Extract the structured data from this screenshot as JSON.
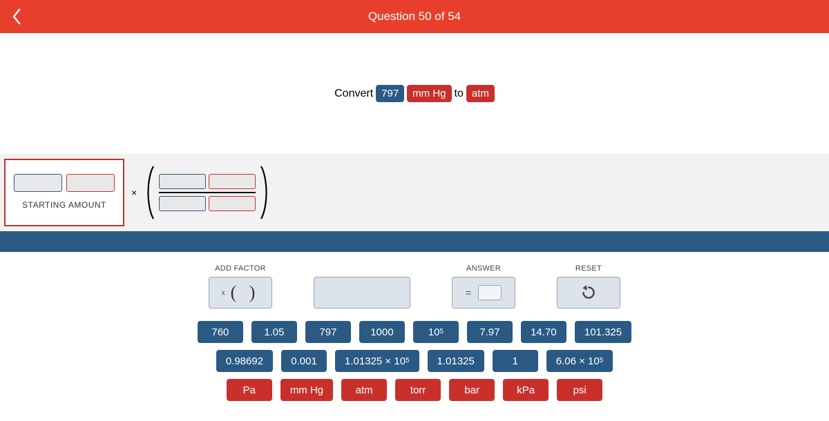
{
  "header": {
    "title": "Question 50 of 54"
  },
  "question": {
    "word_convert": "Convert",
    "value": "797",
    "from_unit": "mm Hg",
    "word_to": "to",
    "to_unit": "atm"
  },
  "equation": {
    "starting_amount_label": "STARTING AMOUNT",
    "multiply_symbol": "×"
  },
  "toolkit": {
    "add_factor_label": "ADD FACTOR",
    "answer_label": "ANSWER",
    "reset_label": "RESET",
    "equals_symbol": "="
  },
  "values_row1": [
    {
      "text": "760"
    },
    {
      "text": "1.05"
    },
    {
      "text": "797"
    },
    {
      "text": "1000"
    },
    {
      "text": "10",
      "sup": "5"
    },
    {
      "text": "7.97"
    },
    {
      "text": "14.70"
    },
    {
      "text": "101.325"
    }
  ],
  "values_row2": [
    {
      "text": "0.98692"
    },
    {
      "text": "0.001"
    },
    {
      "text": "1.01325 × 10",
      "sup": "5"
    },
    {
      "text": "1.01325"
    },
    {
      "text": "1"
    },
    {
      "text": "6.06 × 10",
      "sup": "5"
    }
  ],
  "units_row": [
    {
      "text": "Pa"
    },
    {
      "text": "mm Hg"
    },
    {
      "text": "atm"
    },
    {
      "text": "torr"
    },
    {
      "text": "bar"
    },
    {
      "text": "kPa"
    },
    {
      "text": "psi"
    }
  ]
}
